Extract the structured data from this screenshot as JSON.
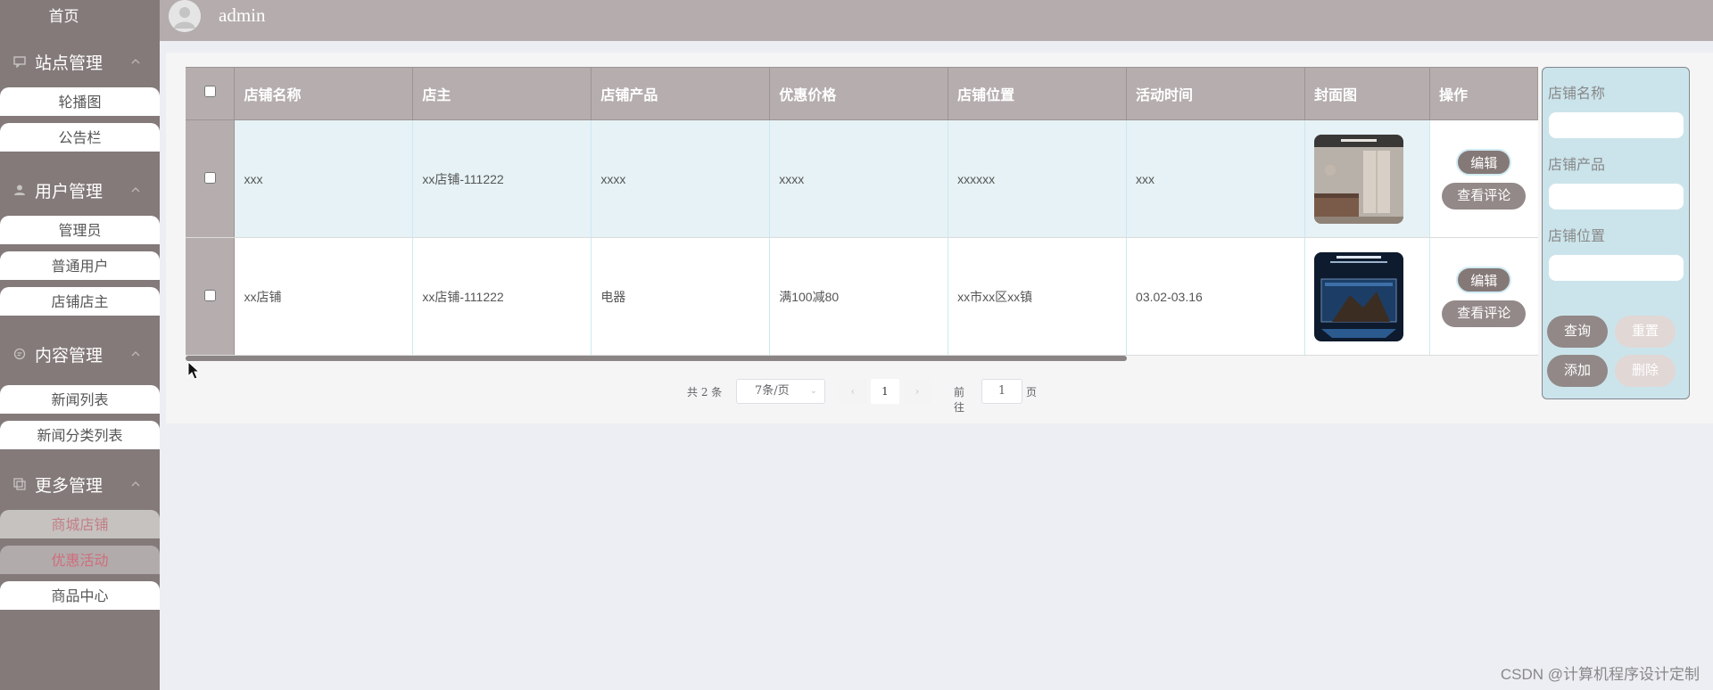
{
  "topbar": {
    "username": "admin"
  },
  "sidebar": {
    "home": "首页",
    "groups": [
      {
        "label": "站点管理",
        "items": [
          "轮播图",
          "公告栏"
        ]
      },
      {
        "label": "用户管理",
        "items": [
          "管理员",
          "普通用户",
          "店铺店主"
        ]
      },
      {
        "label": "内容管理",
        "items": [
          "新闻列表",
          "新闻分类列表"
        ]
      },
      {
        "label": "更多管理",
        "items": [
          "商城店铺",
          "优惠活动",
          "商品中心"
        ]
      }
    ]
  },
  "table": {
    "columns": [
      "店铺名称",
      "店主",
      "店铺产品",
      "优惠价格",
      "店铺位置",
      "活动时间",
      "封面图",
      "操作"
    ],
    "rows": [
      {
        "name": "xxx",
        "owner": "xx店铺-111222",
        "product": "xxxx",
        "price": "xxxx",
        "location": "xxxxxx",
        "time": "xxx",
        "cover_icon": "fridge-kitchen-image"
      },
      {
        "name": "xx店铺",
        "owner": "xx店铺-111222",
        "product": "电器",
        "price": "满100减80",
        "location": "xx市xx区xx镇",
        "time": "03.02-03.16",
        "cover_icon": "tv-promo-image"
      }
    ],
    "actions": {
      "edit": "编辑",
      "review": "查看评论"
    }
  },
  "pagination": {
    "total": "共 2 条",
    "page_size": "7条/页",
    "current_page": "1",
    "goto_label": "前往",
    "goto_value": "1",
    "goto_unit": "页"
  },
  "search": {
    "shop_name_label": "店铺名称",
    "shop_product_label": "店铺产品",
    "shop_location_label": "店铺位置",
    "query": "查询",
    "reset": "重置",
    "add": "添加",
    "delete": "删除"
  },
  "watermark": "CSDN @计算机程序设计定制",
  "colors": {
    "sidebar_bg": "#847a7a",
    "topbar_bg": "#b5adad",
    "header_bg": "#b6aeae",
    "row_highlight": "#e6f2f5",
    "search_panel_bg": "#cbe4eb",
    "active_text": "#c07e85"
  }
}
